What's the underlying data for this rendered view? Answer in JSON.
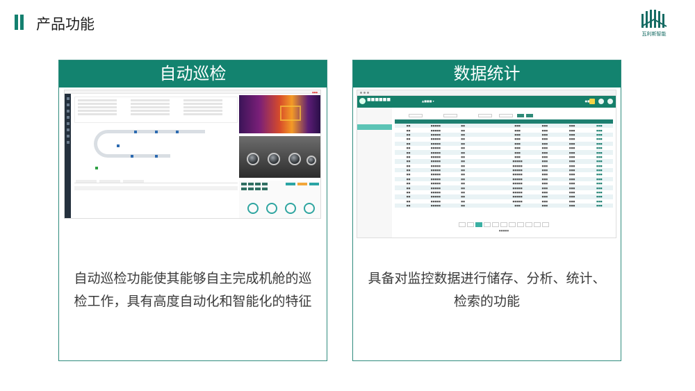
{
  "header": {
    "title": "产品功能",
    "logo_text": "瓦利斯智能",
    "logo_icon": "vertical-bars-logo-icon"
  },
  "colors": {
    "accent": "#13836f",
    "card_border": "#2f8b7d"
  },
  "left_card": {
    "title": "自动巡检",
    "description": "自动巡检功能使其能够自主完成机舱的巡检工作，具有高度自动化和智能化的特征"
  },
  "right_card": {
    "title": "数据统计",
    "description": "具备对监控数据进行储存、分析、统计、检索的功能"
  }
}
